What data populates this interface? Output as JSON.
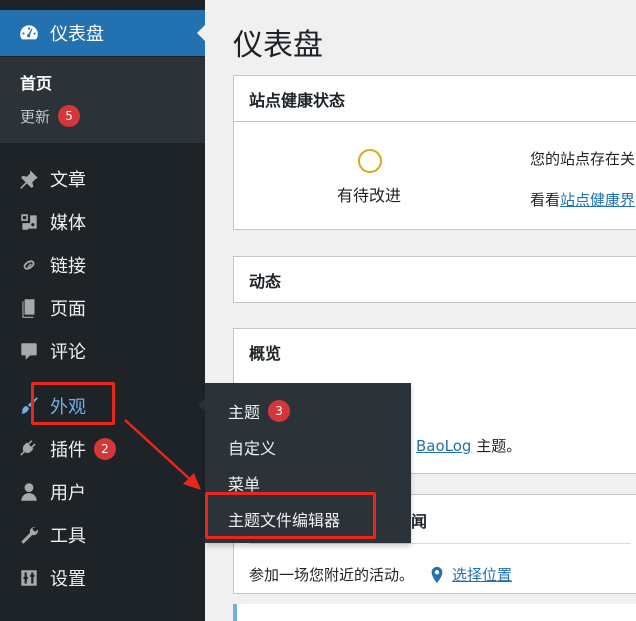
{
  "page_title": "仪表盘",
  "sidebar": {
    "dashboard": {
      "label": "仪表盘",
      "icon": "dashboard-icon"
    },
    "home": "首页",
    "updates": {
      "label": "更新",
      "count": "5"
    },
    "items": [
      {
        "label": "文章",
        "icon": "pushpin-icon"
      },
      {
        "label": "媒体",
        "icon": "media-icon"
      },
      {
        "label": "链接",
        "icon": "link-icon"
      },
      {
        "label": "页面",
        "icon": "page-icon"
      },
      {
        "label": "评论",
        "icon": "comment-icon"
      },
      {
        "label": "外观",
        "icon": "paintbrush-icon"
      },
      {
        "label": "插件",
        "icon": "plugin-icon",
        "count": "2"
      },
      {
        "label": "用户",
        "icon": "user-icon"
      },
      {
        "label": "工具",
        "icon": "wrench-icon"
      },
      {
        "label": "设置",
        "icon": "settings-icon"
      }
    ]
  },
  "flyout": {
    "items": [
      {
        "label": "主题",
        "count": "3"
      },
      {
        "label": "自定义"
      },
      {
        "label": "菜单"
      },
      {
        "label": "主题文件编辑器"
      }
    ]
  },
  "panels": {
    "health": {
      "title": "站点健康状态",
      "status": "有待改进",
      "text": "您的站点存在关",
      "link_prefix": "看看",
      "link": "站点健康界"
    },
    "activity": {
      "title": "动态"
    },
    "overview": {
      "title": "概览",
      "theme_link": "BaoLog",
      "theme_suffix": " 主题。"
    },
    "events": {
      "title_fragment": "闻",
      "text": "参加一场您附近的活动。",
      "location_link": "选择位置"
    }
  },
  "colors": {
    "sidebar_bg": "#1d2327",
    "accent": "#2271b1",
    "badge": "#d63638",
    "highlight": "#e8261b",
    "hover_text": "#72aee6"
  }
}
